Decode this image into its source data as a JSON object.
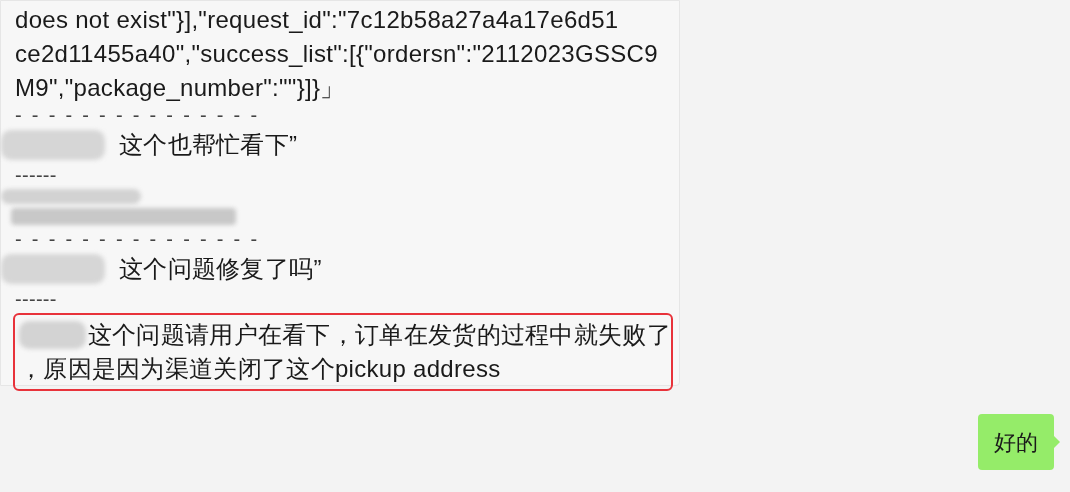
{
  "messages": [
    {
      "kind": "received",
      "lines": [
        {
          "kind": "text",
          "text": "does not exist\"}],\"request_id\":\"7c12b58a27a4a17e6d51"
        },
        {
          "kind": "text",
          "text": "ce2d11455a40\",\"success_list\":[{\"ordersn\":\"2112023GSSC9"
        },
        {
          "kind": "text",
          "text": "M9\",\"package_number\":\"\"}]}」"
        },
        {
          "kind": "separator",
          "text": "- - - - - - - - - - - - - - -"
        },
        {
          "kind": "redacted_text",
          "text": "这个也帮忙看下”"
        },
        {
          "kind": "separator",
          "text": "------"
        },
        {
          "kind": "redacted"
        },
        {
          "kind": "separator",
          "text": "- - - - - - - - - - - - - - -"
        },
        {
          "kind": "redacted_text",
          "text": "这个问题修复了吗”"
        },
        {
          "kind": "separator",
          "text": "------"
        },
        {
          "kind": "highlighted",
          "lines": [
            "这个问题请用户在看下，订单在发货的过程中就失败了",
            "，原因是因为渠道关闭了这个pickup address"
          ]
        }
      ]
    },
    {
      "kind": "sent",
      "lines": [
        {
          "kind": "text",
          "text": "好的"
        }
      ]
    }
  ]
}
